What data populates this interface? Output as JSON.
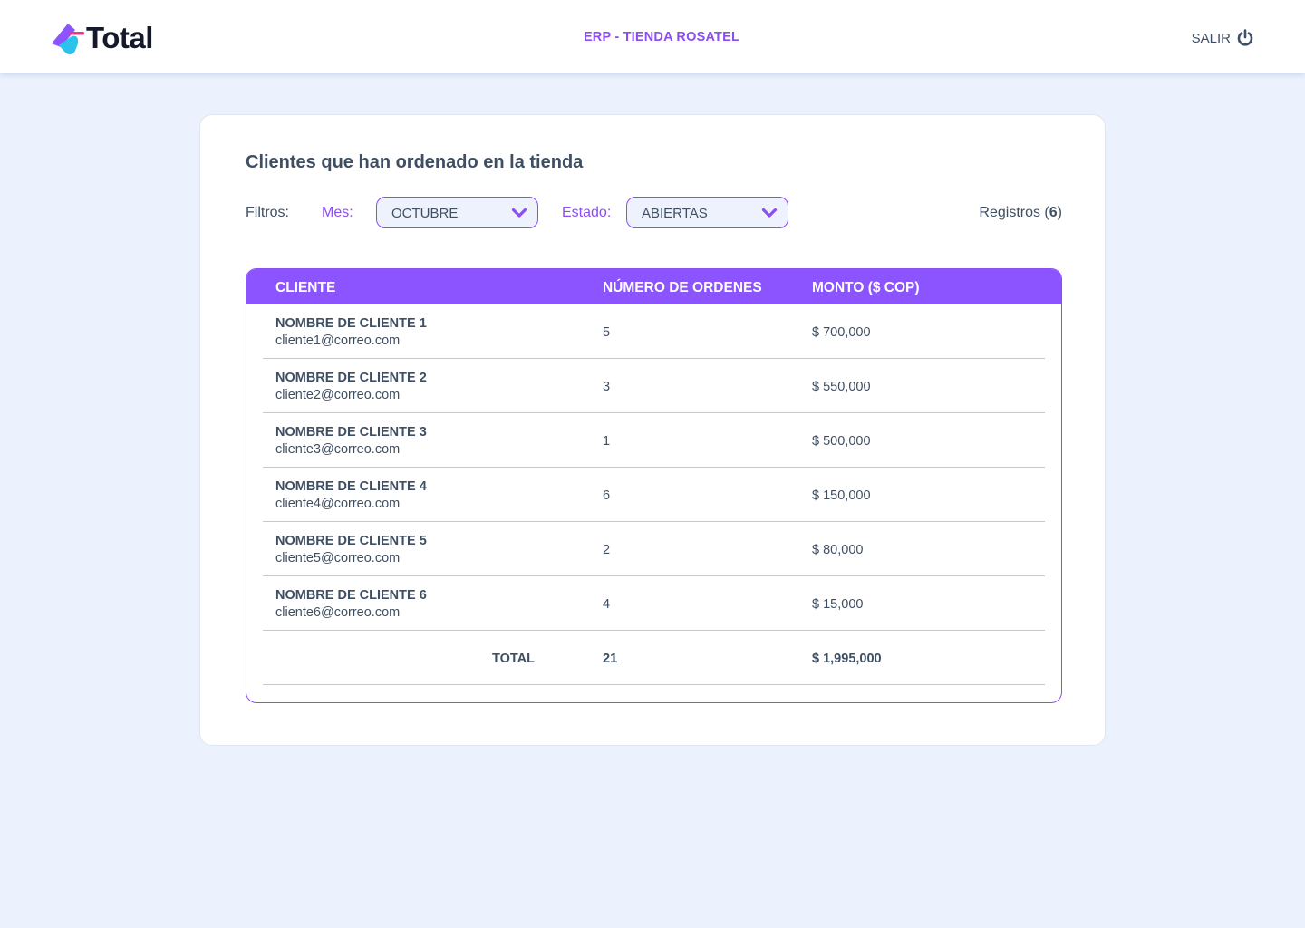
{
  "header": {
    "logo_text": "Total",
    "app_title": "ERP - TIENDA ROSATEL",
    "logout_label": "SALIR",
    "logout_icon": "power-icon"
  },
  "main": {
    "title": "Clientes que han ordenado en la tienda",
    "filters": {
      "label": "Filtros:",
      "month_label": "Mes:",
      "month_value": "OCTUBRE",
      "status_label": "Estado:",
      "status_value": "ABIERTAS"
    },
    "records": {
      "label_prefix": "Registros (",
      "count": "6",
      "label_suffix": ")"
    }
  },
  "table": {
    "columns": [
      "CLIENTE",
      "NÚMERO DE ORDENES",
      "MONTO ($ COP)"
    ],
    "rows": [
      {
        "name": "NOMBRE DE CLIENTE 1",
        "email": "cliente1@correo.com",
        "orders": "5",
        "amount": "$ 700,000"
      },
      {
        "name": "NOMBRE DE CLIENTE 2",
        "email": "cliente2@correo.com",
        "orders": "3",
        "amount": "$ 550,000"
      },
      {
        "name": "NOMBRE DE CLIENTE 3",
        "email": "cliente3@correo.com",
        "orders": "1",
        "amount": "$ 500,000"
      },
      {
        "name": "NOMBRE DE CLIENTE 4",
        "email": "cliente4@correo.com",
        "orders": "6",
        "amount": "$ 150,000"
      },
      {
        "name": "NOMBRE DE CLIENTE 5",
        "email": "cliente5@correo.com",
        "orders": "2",
        "amount": "$ 80,000"
      },
      {
        "name": "NOMBRE DE CLIENTE 6",
        "email": "cliente6@correo.com",
        "orders": "4",
        "amount": "$ 15,000"
      }
    ],
    "total": {
      "label": "TOTAL",
      "orders": "21",
      "amount": "$ 1,995,000"
    }
  },
  "colors": {
    "accent": "#8c4df2",
    "header_bg": "#8b54ff",
    "page_bg": "#ebf2fd",
    "text": "#3f4f63"
  }
}
